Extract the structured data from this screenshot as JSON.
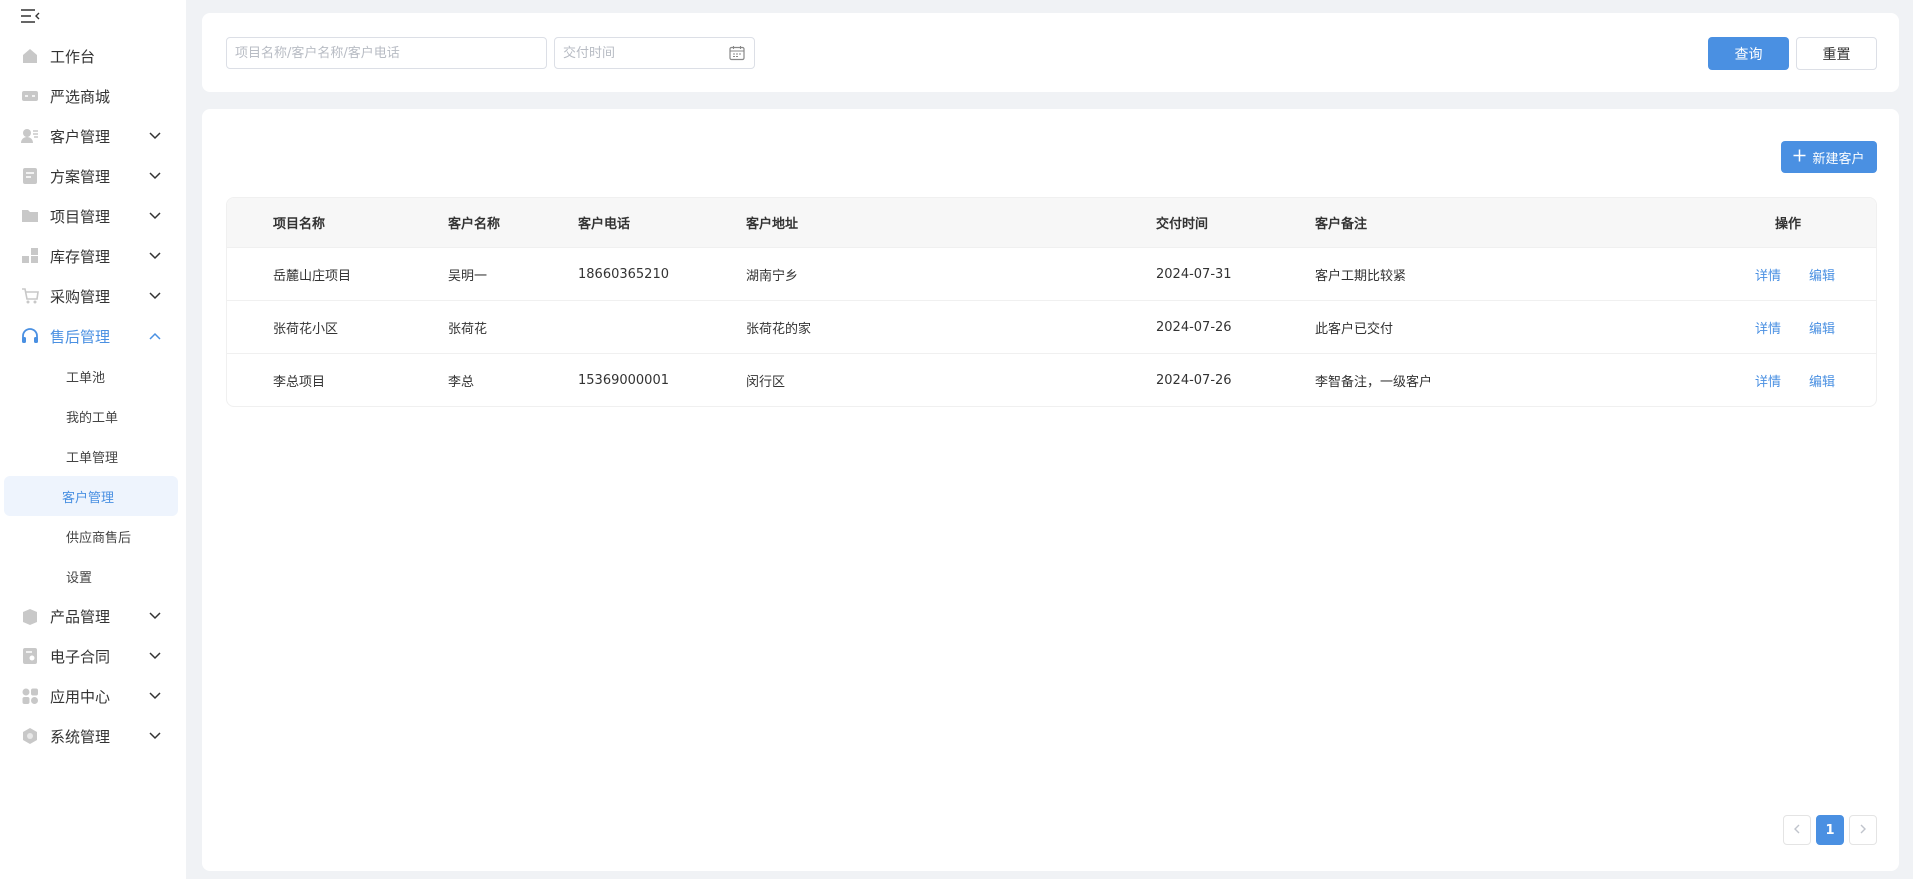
{
  "sidebar": {
    "items": [
      {
        "label": "工作台"
      },
      {
        "label": "严选商城"
      },
      {
        "label": "客户管理"
      },
      {
        "label": "方案管理"
      },
      {
        "label": "项目管理"
      },
      {
        "label": "库存管理"
      },
      {
        "label": "采购管理"
      },
      {
        "label": "售后管理"
      },
      {
        "label": "产品管理"
      },
      {
        "label": "电子合同"
      },
      {
        "label": "应用中心"
      },
      {
        "label": "系统管理"
      }
    ],
    "submenu": [
      {
        "label": "工单池"
      },
      {
        "label": "我的工单"
      },
      {
        "label": "工单管理"
      },
      {
        "label": "客户管理"
      },
      {
        "label": "供应商售后"
      },
      {
        "label": "设置"
      }
    ],
    "active_color": "#4a90e2"
  },
  "search": {
    "keyword_placeholder": "项目名称/客户名称/客户电话",
    "date_placeholder": "交付时间",
    "query_label": "查询",
    "reset_label": "重置"
  },
  "toolbar": {
    "new_customer_label": "新建客户"
  },
  "table": {
    "headers": [
      "项目名称",
      "客户名称",
      "客户电话",
      "客户地址",
      "交付时间",
      "客户备注",
      "操作"
    ],
    "rows": [
      {
        "project": "岳麓山庄项目",
        "customer": "吴明一",
        "phone": "18660365210",
        "address": "湖南宁乡",
        "date": "2024-07-31",
        "note": "客户工期比较紧"
      },
      {
        "project": "张荷花小区",
        "customer": "张荷花",
        "phone": "",
        "address": "张荷花的家",
        "date": "2024-07-26",
        "note": "此客户已交付"
      },
      {
        "project": "李总项目",
        "customer": "李总",
        "phone": "15369000001",
        "address": "闵行区",
        "date": "2024-07-26",
        "note": "李智备注，一级客户"
      }
    ],
    "action_detail": "详情",
    "action_edit": "编辑"
  },
  "pagination": {
    "current_page": "1"
  }
}
